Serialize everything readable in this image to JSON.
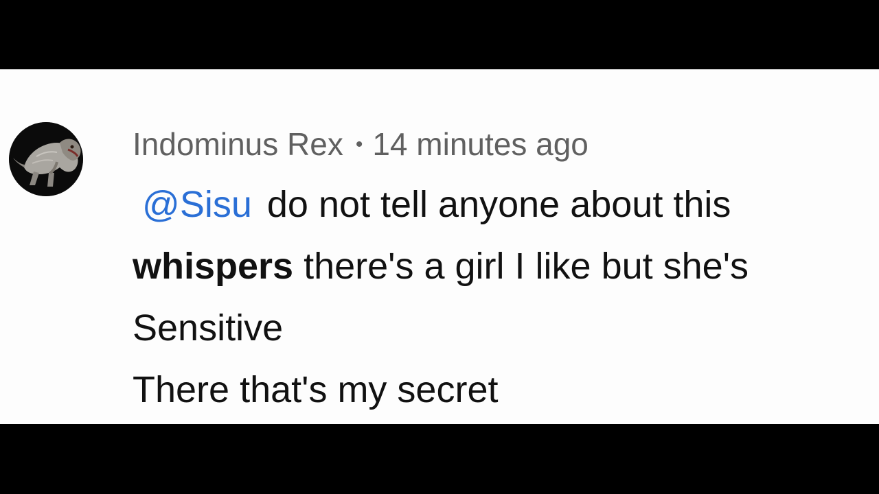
{
  "comment": {
    "author": "Indominus Rex",
    "separator": "•",
    "timestamp": "14 minutes ago",
    "avatar_icon": "dinosaur-avatar-icon",
    "mention": "@Sisu",
    "line1_text": "do not tell anyone about this",
    "line2_bold": "whispers",
    "line2_text": " there's a girl I like but she's",
    "line3_text": "Sensitive",
    "line4_text": "There that's my secret"
  },
  "colors": {
    "mention": "#2a6fd6",
    "meta_text": "#606060",
    "body_text": "#111111",
    "panel_background": "#fdfdfd",
    "letterbox": "#000000"
  }
}
